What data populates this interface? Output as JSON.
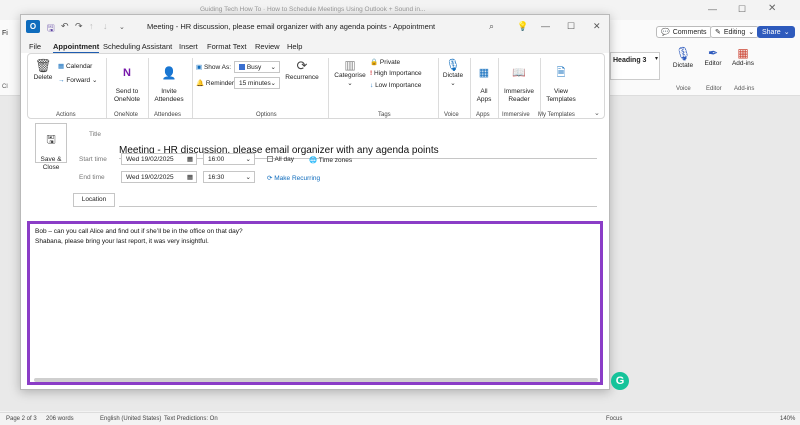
{
  "background": {
    "title_fragment": "Guiding Tech How To · How to Schedule Meetings Using Outlook + Sound in...",
    "comments_label": "Comments",
    "editing_label": "Editing",
    "share_label": "Share",
    "heading_style": "Heading 3",
    "dictate_label": "Dictate",
    "editor_label": "Editor",
    "addins_label": "Add-ins",
    "group_voice": "Voice",
    "group_editor": "Editor",
    "group_addins": "Add-ins",
    "file_fragment": "Fi",
    "cl_fragment": "Cl",
    "status": {
      "page": "Page 2 of 3",
      "words": "206 words",
      "language": "English (United States)",
      "predictions": "Text Predictions: On",
      "focus": "Focus",
      "zoom": "140%"
    }
  },
  "outlook": {
    "title": "Meeting - HR discussion, please email organizer with any agenda points  -  Appointment",
    "menu": [
      "File",
      "Appointment",
      "Scheduling Assistant",
      "Insert",
      "Format Text",
      "Review",
      "Help"
    ],
    "ribbon": {
      "delete": "Delete",
      "calendar": "Calendar",
      "forward": "Forward",
      "group_actions": "Actions",
      "send_onenote": "Send to\nOneNote",
      "group_onenote": "OneNote",
      "invite_attendees": "Invite\nAttendees",
      "group_attendees": "Attendees",
      "show_as_label": "Show As:",
      "show_as_value": "Busy",
      "reminder_label": "Reminder:",
      "reminder_value": "15 minutes",
      "recurrence": "Recurrence",
      "group_options": "Options",
      "categorise": "Categorise",
      "private": "Private",
      "high_importance": "High Importance",
      "low_importance": "Low Importance",
      "group_tags": "Tags",
      "dictate": "Dictate",
      "group_voice": "Voice",
      "all_apps": "All\nApps",
      "group_apps": "Apps",
      "immersive_reader": "Immersive\nReader",
      "group_immersive": "Immersive",
      "view_templates": "View\nTemplates",
      "group_templates": "My Templates"
    },
    "form": {
      "save_close": "Save &\nClose",
      "title_label": "Title",
      "subject": "Meeting - HR discussion, please email organizer with any agenda points",
      "start_label": "Start time",
      "start_date": "Wed 19/02/2025",
      "start_time": "16:00",
      "all_day": "All day",
      "time_zones": "Time zones",
      "end_label": "End time",
      "end_date": "Wed 19/02/2025",
      "end_time": "16:30",
      "make_recurring": "Make Recurring",
      "location": "Location"
    },
    "notes": [
      "Bob – can you call Alice and find out if she’ll be in the office on that day?",
      "Shabana, please bring your last report, it was very insightful."
    ]
  },
  "colors": {
    "accent": "#1f5db0",
    "highlight_border": "#8b3dc7",
    "share": "#2f5bbd",
    "grammarly": "#15c39a"
  }
}
